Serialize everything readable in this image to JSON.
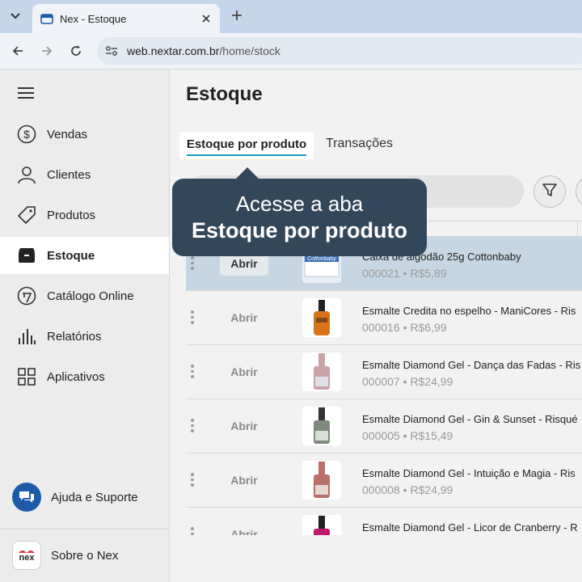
{
  "browser": {
    "tab_title": "Nex - Estoque",
    "url_host": "web.nextar.com.br",
    "url_path": "/home/stock"
  },
  "sidebar": {
    "items": [
      {
        "label": "Vendas",
        "icon": "dollar-circle-icon"
      },
      {
        "label": "Clientes",
        "icon": "person-icon"
      },
      {
        "label": "Produtos",
        "icon": "tag-icon"
      },
      {
        "label": "Estoque",
        "icon": "box-icon",
        "active": true
      },
      {
        "label": "Catálogo Online",
        "icon": "catalog-icon"
      },
      {
        "label": "Relatórios",
        "icon": "bar-chart-icon"
      },
      {
        "label": "Aplicativos",
        "icon": "apps-grid-icon"
      }
    ],
    "help_label": "Ajuda e Suporte",
    "about_label": "Sobre o Nex",
    "nex_logo_text": "nex"
  },
  "main": {
    "title": "Estoque",
    "tabs": [
      {
        "label": "Estoque por produto",
        "active": true
      },
      {
        "label": "Transações"
      }
    ]
  },
  "tooltip": {
    "line1": "Acesse a aba",
    "line2": "Estoque por produto"
  },
  "open_label": "Abrir",
  "products": [
    {
      "name": "Caixa de algodão 25g Cottonbaby",
      "code": "000021",
      "price": "R$5,89",
      "highlight": true,
      "swatch": "#3b6fb6",
      "label_text": "Cottonbaby"
    },
    {
      "name": "Esmalte Credita no espelho - ManiCores - Ris",
      "code": "000016",
      "price": "R$6,99",
      "swatch": "#d9731a"
    },
    {
      "name": "Esmalte Diamond Gel - Dança das Fadas - Ris",
      "code": "000007",
      "price": "R$24,99",
      "swatch": "#c9a3a8"
    },
    {
      "name": "Esmalte Diamond Gel - Gin & Sunset - Risqué",
      "code": "000005",
      "price": "R$15,49",
      "swatch": "#7d8a7c"
    },
    {
      "name": "Esmalte Diamond Gel - Intuição e Magia - Ris",
      "code": "000008",
      "price": "R$24,99",
      "swatch": "#b8706a"
    },
    {
      "name": "Esmalte Diamond Gel - Licor de Cranberry - R",
      "code": "",
      "price": "",
      "swatch": "#c0186a"
    }
  ],
  "colors": {
    "accent": "#1aa0c8",
    "tooltip_bg": "#33475a",
    "help_icon_bg": "#1d5aa8",
    "highlight_row": "#c6d7e3"
  }
}
